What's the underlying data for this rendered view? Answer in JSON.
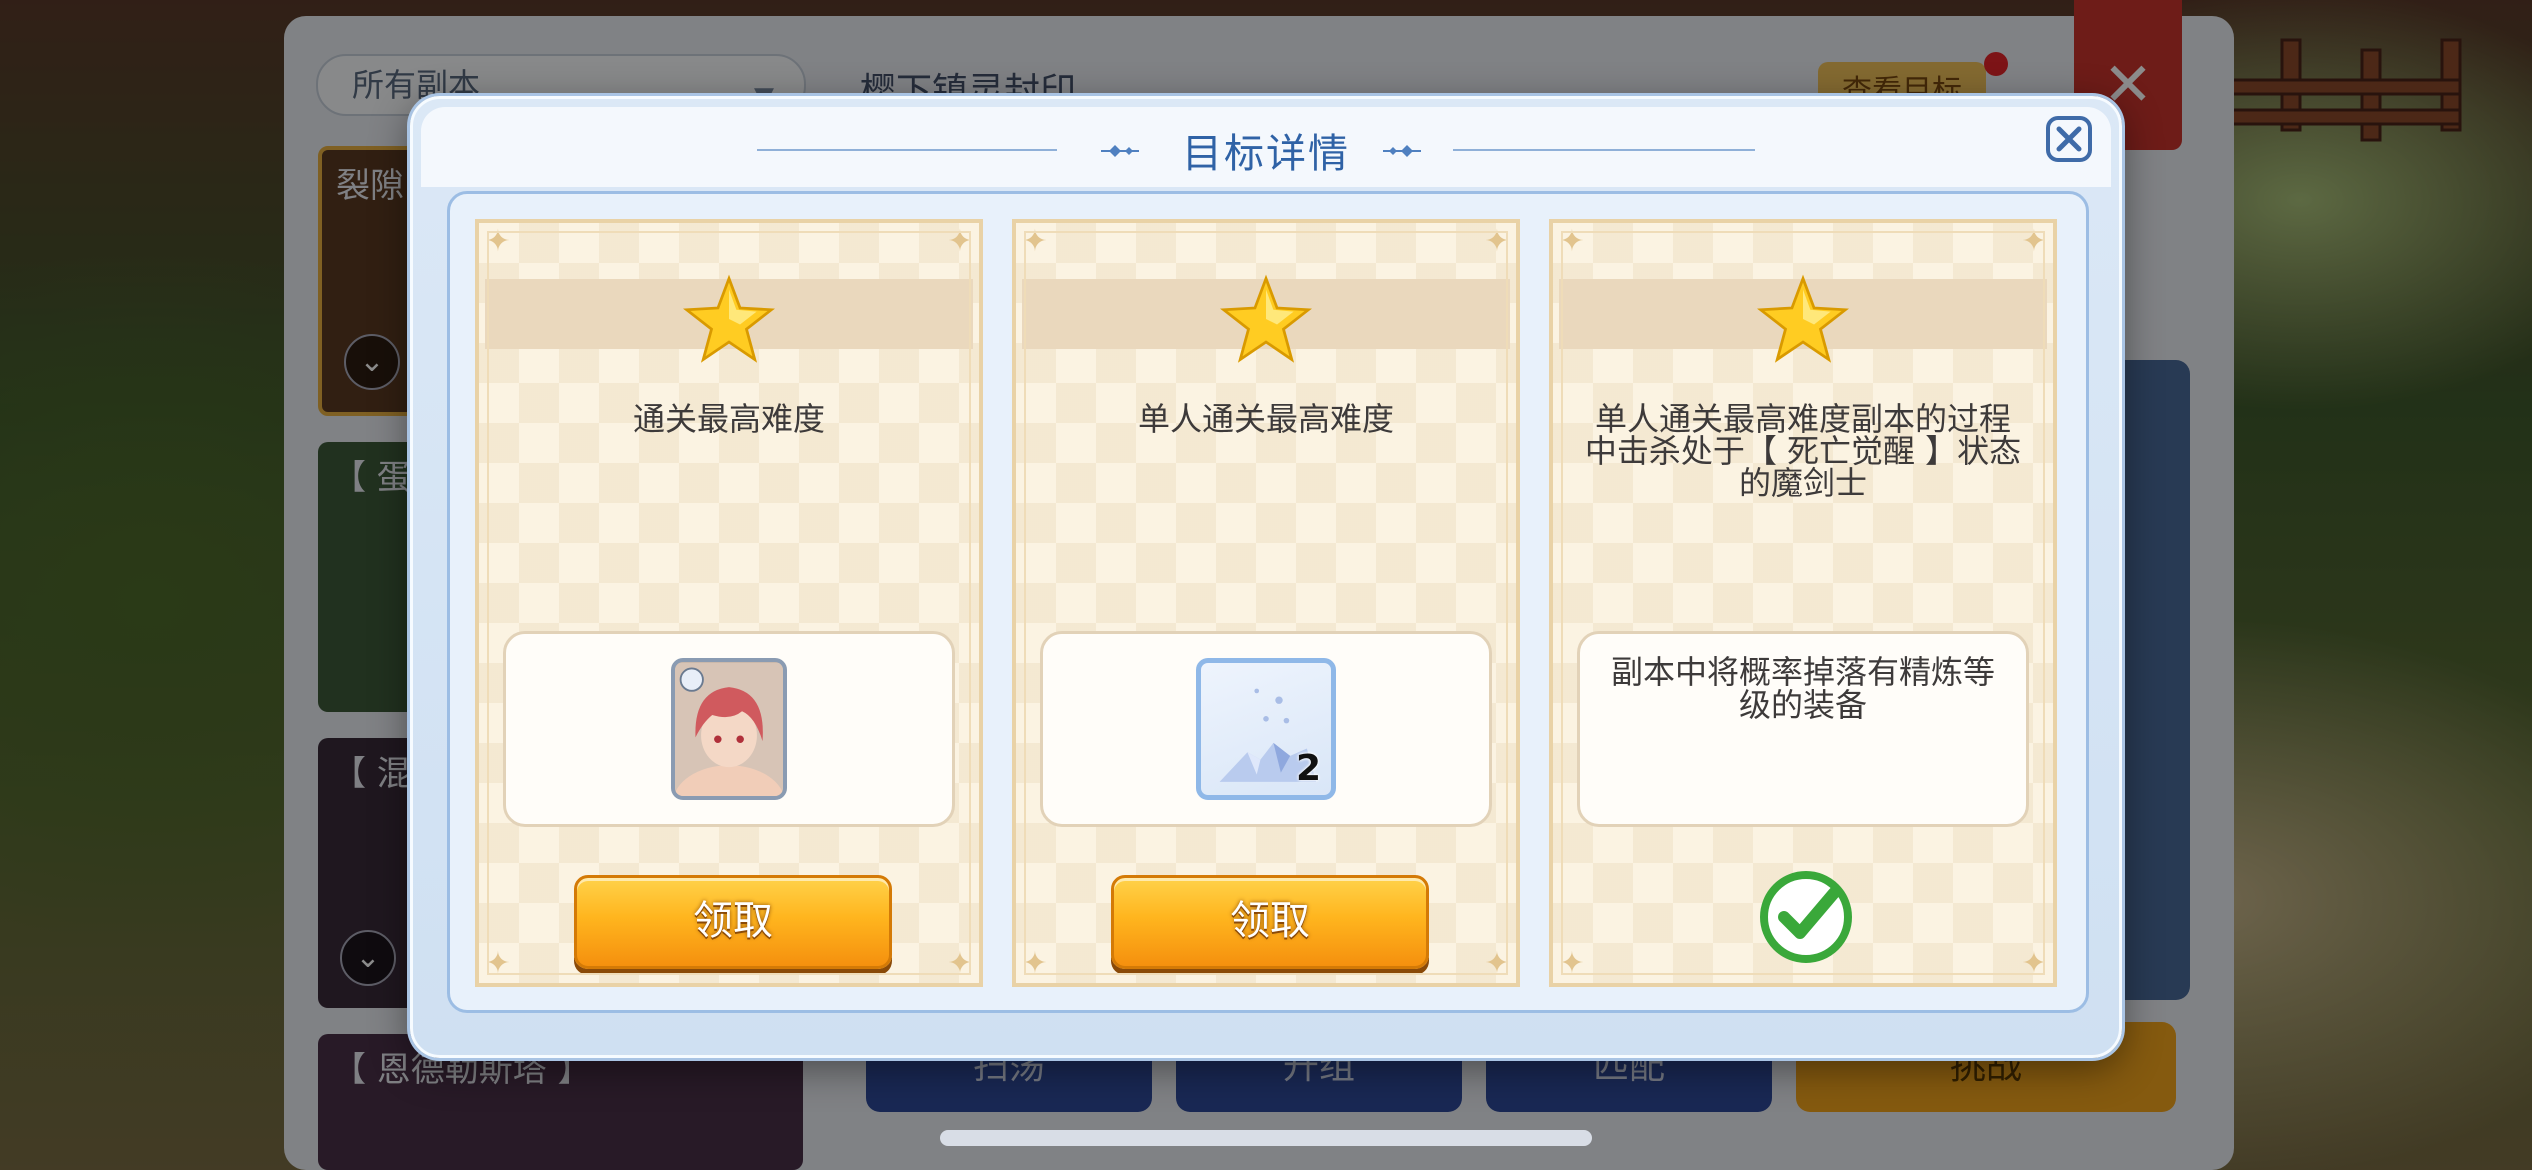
{
  "background": {
    "filter_label": "所有副本",
    "header_title": "樱下镇灵封印",
    "view_goal_label": "查看目标",
    "dungeon_cards": [
      "裂隙",
      "【 蛋糕",
      "【 混沌",
      "【 恩德勒斯塔 】"
    ],
    "bottom_buttons": [
      "扫荡",
      "升组",
      "匹配",
      "挑战"
    ]
  },
  "modal": {
    "title": "目标详情",
    "close_icon": "close-icon",
    "goals": [
      {
        "description": "通关最高难度",
        "reward_type": "item",
        "reward_icon": "character-portrait-icon",
        "reward_count": "",
        "action": "claim",
        "button_label": "领取"
      },
      {
        "description": "单人通关最高难度",
        "reward_type": "item",
        "reward_icon": "crystal-shards-icon",
        "reward_count": "2",
        "action": "claim",
        "button_label": "领取"
      },
      {
        "description": "单人通关最高难度副本的过程中击杀处于【 死亡觉醒 】状态的魔剑士",
        "reward_type": "text",
        "reward_text": "副本中将概率掉落有精炼等级的装备",
        "action": "completed",
        "status_icon": "checkmark-icon"
      }
    ]
  },
  "colors": {
    "title_blue": "#2f62a6",
    "button_orange": "#ffb51e",
    "check_green": "#3aa83a",
    "star_gold": "#ffcc22"
  }
}
